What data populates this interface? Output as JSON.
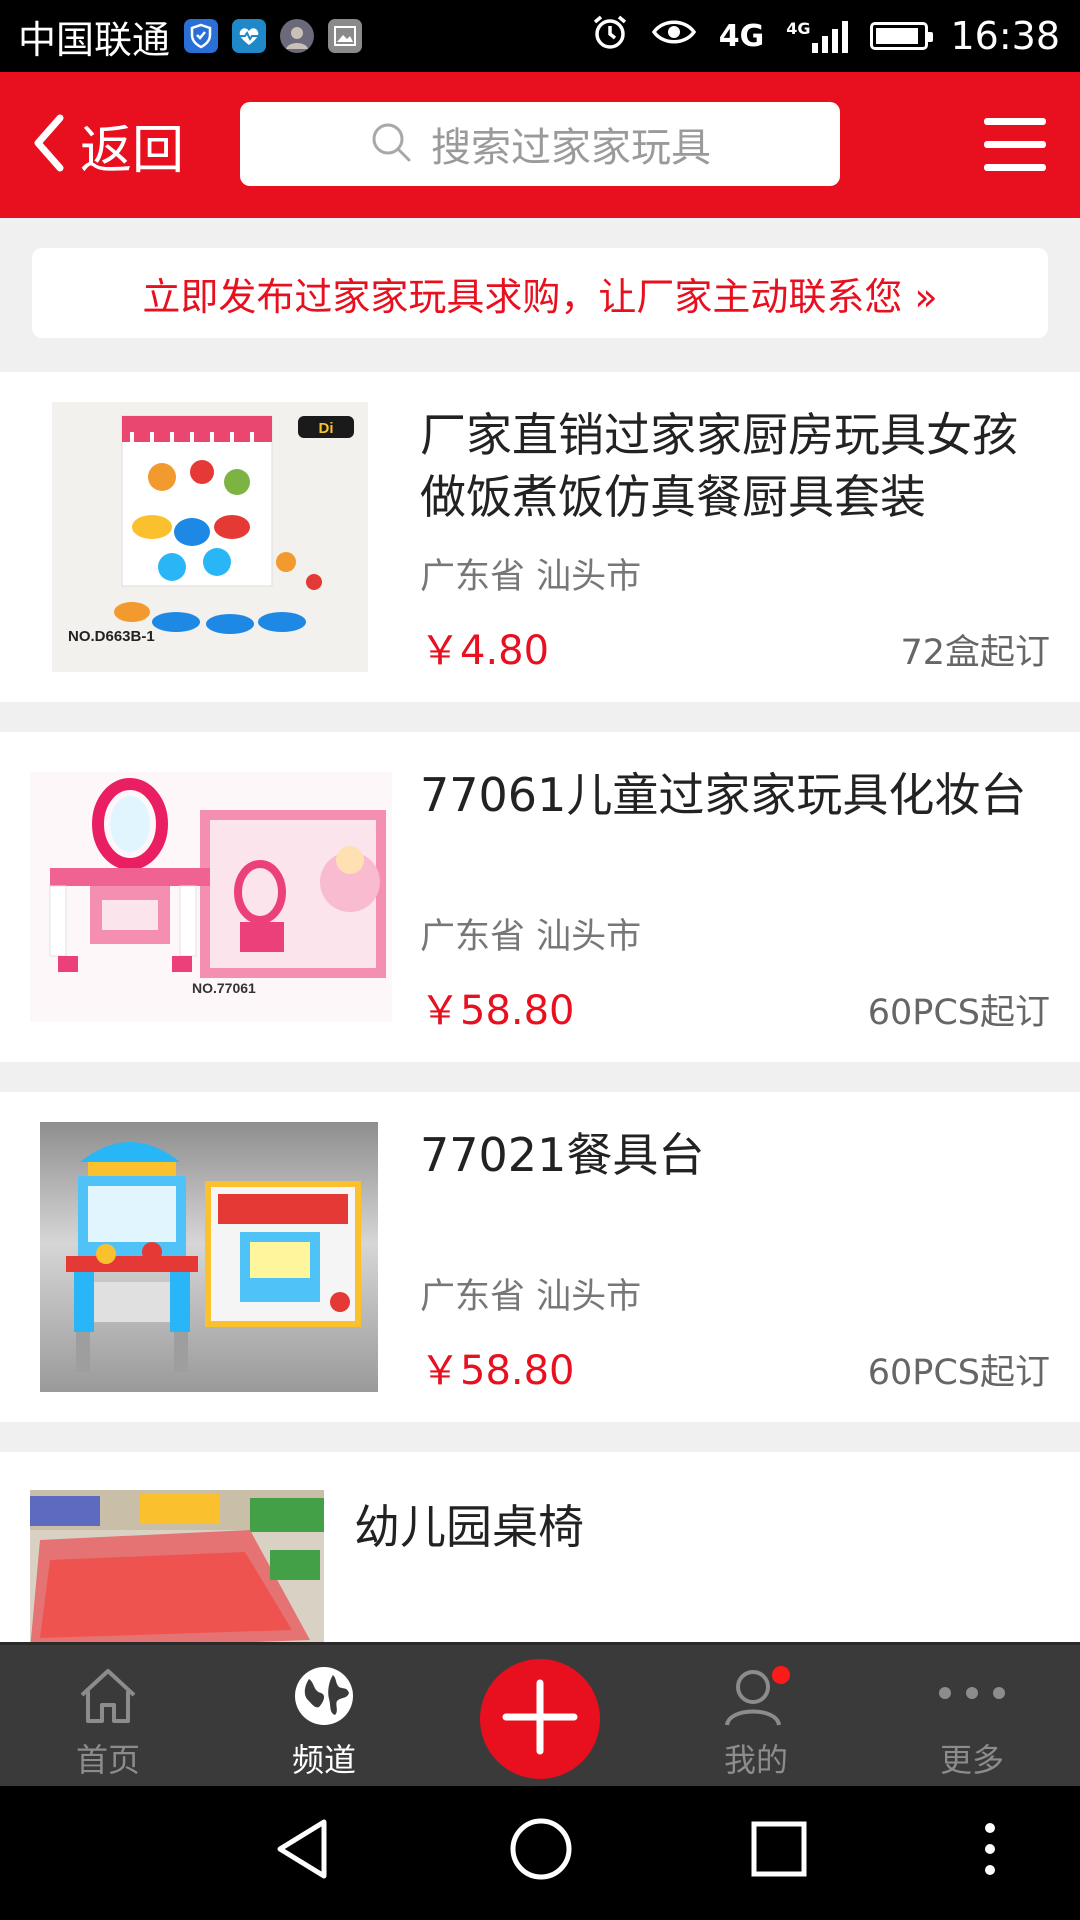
{
  "status_bar": {
    "carrier": "中国联通",
    "network": "4G",
    "network_small": "4G",
    "time": "16:38"
  },
  "header": {
    "back_label": "返回",
    "search_placeholder": "搜索过家家玩具"
  },
  "banner": {
    "text": "立即发布过家家玩具求购，让厂家主动联系您 »"
  },
  "products": [
    {
      "title": "厂家直销过家家厨房玩具女孩做饭煮饭仿真餐厨具套装",
      "location": "广东省 汕头市",
      "price": "￥4.80",
      "min_order": "72盒起订",
      "image_caption": "NO.D663B-1"
    },
    {
      "title": "77061儿童过家家玩具化妆台",
      "location": "广东省 汕头市",
      "price": "￥58.80",
      "min_order": "60PCS起订",
      "image_caption": "NO.77061"
    },
    {
      "title": "77021餐具台",
      "location": "广东省 汕头市",
      "price": "￥58.80",
      "min_order": "60PCS起订"
    },
    {
      "title": "幼儿园桌椅"
    }
  ],
  "bottom_nav": {
    "items": [
      {
        "label": "首页",
        "icon": "home-icon"
      },
      {
        "label": "频道",
        "icon": "globe-icon",
        "active": true
      },
      {
        "label": "我的",
        "icon": "user-icon"
      },
      {
        "label": "更多",
        "icon": "more-icon"
      }
    ],
    "fab_icon": "plus-icon"
  },
  "colors": {
    "brand_red": "#e8101f",
    "nav_bg": "#3a3a3a"
  }
}
